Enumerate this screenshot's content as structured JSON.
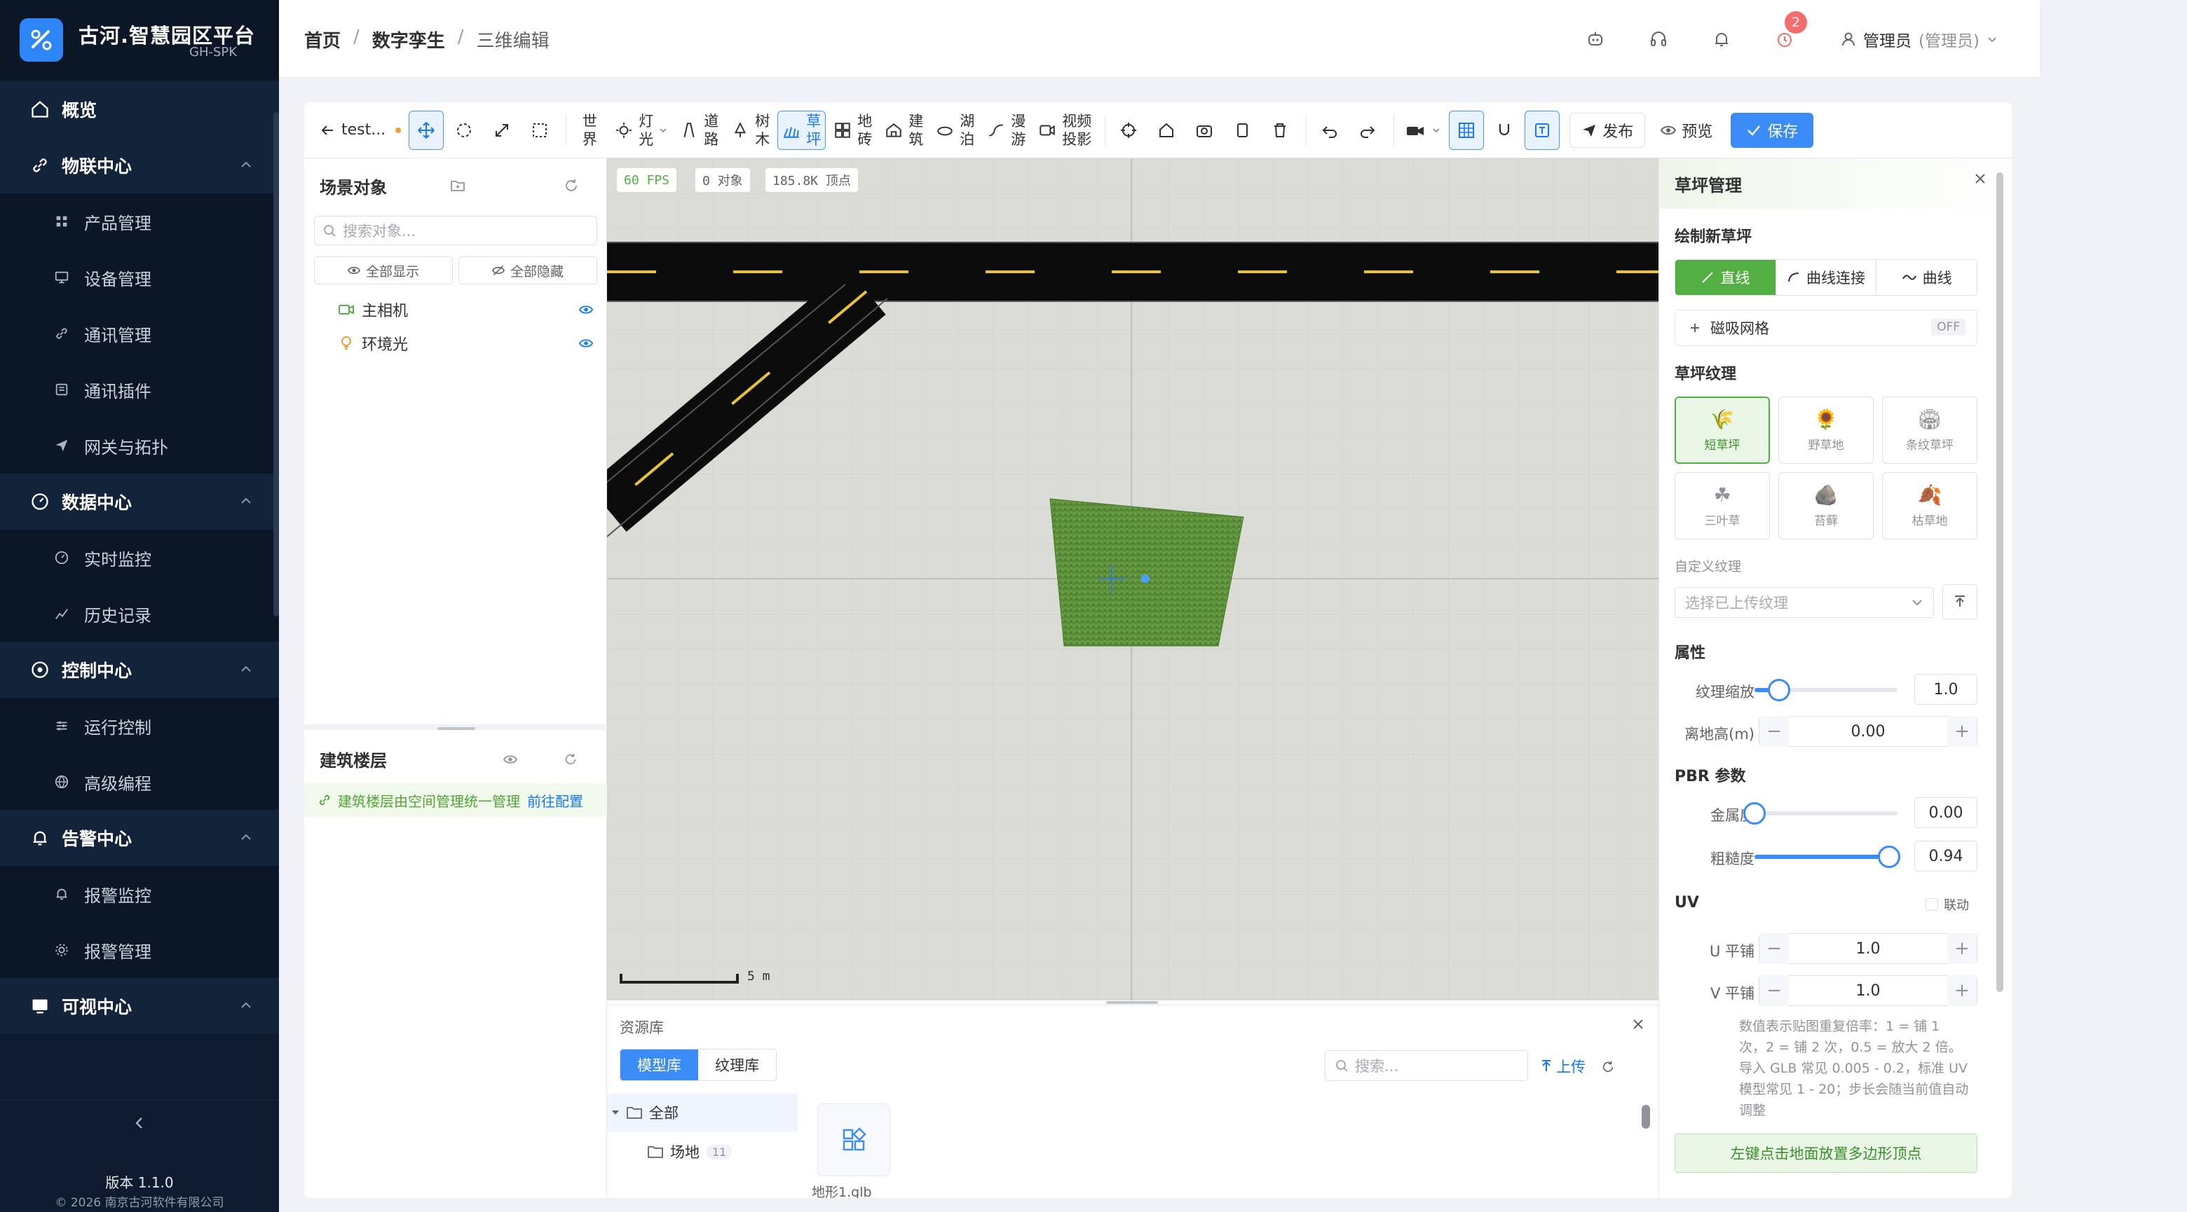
{
  "app": {
    "title": "古河.智慧园区平台",
    "subtitle": "GH-SPK"
  },
  "sidebar": {
    "items": [
      {
        "label": "概览",
        "icon": "home-icon",
        "type": "group"
      },
      {
        "label": "物联中心",
        "icon": "link-icon",
        "type": "group"
      },
      {
        "label": "产品管理",
        "icon": "grid-icon",
        "type": "sub"
      },
      {
        "label": "设备管理",
        "icon": "monitor-icon",
        "type": "sub"
      },
      {
        "label": "通讯管理",
        "icon": "link-icon",
        "type": "sub"
      },
      {
        "label": "通讯插件",
        "icon": "plugin-icon",
        "type": "sub"
      },
      {
        "label": "网关与拓扑",
        "icon": "send-icon",
        "type": "sub"
      },
      {
        "label": "数据中心",
        "icon": "gauge-icon",
        "type": "group"
      },
      {
        "label": "实时监控",
        "icon": "gauge-icon",
        "type": "sub"
      },
      {
        "label": "历史记录",
        "icon": "chart-icon",
        "type": "sub"
      },
      {
        "label": "控制中心",
        "icon": "dial-icon",
        "type": "group"
      },
      {
        "label": "运行控制",
        "icon": "sliders-icon",
        "type": "sub"
      },
      {
        "label": "高级编程",
        "icon": "globe-icon",
        "type": "sub"
      },
      {
        "label": "告警中心",
        "icon": "bell-icon",
        "type": "group"
      },
      {
        "label": "报警监控",
        "icon": "bell-icon",
        "type": "sub"
      },
      {
        "label": "报警管理",
        "icon": "gear-icon",
        "type": "sub"
      },
      {
        "label": "可视中心",
        "icon": "screen-icon",
        "type": "group"
      }
    ],
    "version": "版本 1.1.0",
    "copyright": "© 2026 南京古河软件有限公司"
  },
  "header": {
    "breadcrumb": [
      "首页",
      "数字孪生",
      "三维编辑"
    ],
    "alarm_badge": "2",
    "user_name": "管理员",
    "user_role": "(管理员)"
  },
  "toolbar": {
    "back_label": "test...",
    "tools": [
      {
        "top": "世",
        "bottom": "界"
      },
      {
        "top": "灯",
        "bottom": "光"
      },
      {
        "top": "道",
        "bottom": "路"
      },
      {
        "top": "树",
        "bottom": "木"
      },
      {
        "top": "草",
        "bottom": "坪"
      },
      {
        "top": "地",
        "bottom": "砖"
      },
      {
        "top": "建",
        "bottom": "筑"
      },
      {
        "top": "湖",
        "bottom": "泊"
      },
      {
        "top": "漫",
        "bottom": "游"
      },
      {
        "top": "视频",
        "bottom": "投影"
      }
    ],
    "publish_label": "发布",
    "preview_label": "预览",
    "save_label": "保存"
  },
  "scene": {
    "title": "场景对象",
    "search_placeholder": "搜索对象...",
    "show_all": "全部显示",
    "hide_all": "全部隐藏",
    "objects": [
      {
        "label": "主相机",
        "icon": "camera-icon"
      },
      {
        "label": "环境光",
        "icon": "bulb-icon"
      }
    ]
  },
  "building": {
    "title": "建筑楼层",
    "note": "建筑楼层由空间管理统一管理",
    "link": "前往配置"
  },
  "viewport": {
    "fps": "60 FPS",
    "objects": "0 对象",
    "vertices": "185.8K 顶点",
    "scale_label": "5 m"
  },
  "resource": {
    "title": "资源库",
    "tabs": [
      "模型库",
      "纹理库"
    ],
    "search_placeholder": "搜索...",
    "upload": "上传",
    "tree_all": "全部",
    "tree_site": "场地",
    "tree_site_count": "11",
    "asset_name": "地形1.glb"
  },
  "lawn": {
    "title": "草坪管理",
    "draw_title": "绘制新草坪",
    "modes": [
      "直线",
      "曲线连接",
      "曲线"
    ],
    "snap_label": "磁吸网格",
    "snap_state": "OFF",
    "texture_title": "草坪纹理",
    "textures": [
      {
        "label": "短草坪",
        "emoji": "🌾"
      },
      {
        "label": "野草地",
        "emoji": "🌻"
      },
      {
        "label": "条纹草坪",
        "emoji": "🏟"
      },
      {
        "label": "三叶草",
        "emoji": "☘"
      },
      {
        "label": "苔藓",
        "emoji": "🪨"
      },
      {
        "label": "枯草地",
        "emoji": "🍂"
      }
    ],
    "custom_label": "自定义纹理",
    "custom_placeholder": "选择已上传纹理",
    "props_title": "属性",
    "scale_label": "纹理缩放",
    "scale_value": "1.0",
    "scale_fraction": 0.17,
    "height_label": "离地高(m)",
    "height_value": "0.00",
    "pbr_title": "PBR 参数",
    "metal_label": "金属度",
    "metal_value": "0.00",
    "metal_fraction": 0.0,
    "rough_label": "粗糙度",
    "rough_value": "0.94",
    "rough_fraction": 0.94,
    "uv_title": "UV",
    "link_label": "联动",
    "u_label": "U 平铺",
    "u_value": "1.0",
    "v_label": "V 平铺",
    "v_value": "1.0",
    "uv_note": "数值表示贴图重复倍率：1 = 铺 1 次，2 = 铺 2 次，0.5 = 放大 2 倍。导入 GLB 常见 0.005 - 0.2，标准 UV 模型常见 1 - 20；步长会随当前值自动调整",
    "place_hint": "左键点击地面放置多边形顶点"
  },
  "colors": {
    "accent": "#3b8cf7",
    "green": "#52b043",
    "sidebar": "#0e1b2e"
  }
}
